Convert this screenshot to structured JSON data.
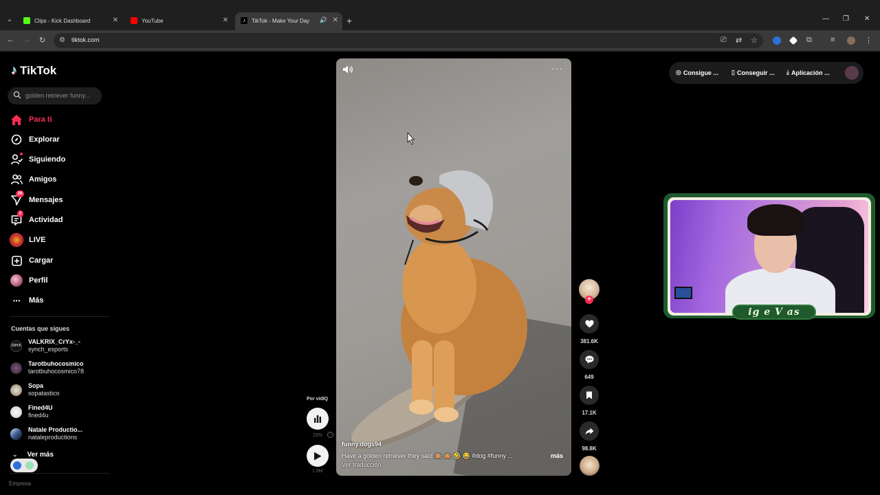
{
  "browser": {
    "tabs": [
      {
        "title": "Clips - Kick Dashboard",
        "favicon_color": "#53fc18"
      },
      {
        "title": "YouTube",
        "favicon_color": "#ff0000"
      },
      {
        "title": "TikTok - Make Your Day",
        "favicon_color": "#ffffff",
        "active": true
      }
    ],
    "url": "tiktok.com"
  },
  "tiktok": {
    "logo": "TikTok",
    "search_placeholder": "golden retriever funny...",
    "nav": [
      {
        "label": "Para ti",
        "icon": "home-icon",
        "active": true
      },
      {
        "label": "Explorar",
        "icon": "compass-icon"
      },
      {
        "label": "Siguiendo",
        "icon": "following-icon"
      },
      {
        "label": "Amigos",
        "icon": "friends-icon"
      },
      {
        "label": "Mensajes",
        "icon": "messages-icon",
        "badge": "28"
      },
      {
        "label": "Actividad",
        "icon": "activity-icon",
        "badge": "2"
      },
      {
        "label": "LIVE",
        "icon": "live-icon"
      },
      {
        "label": "Cargar",
        "icon": "upload-icon"
      },
      {
        "label": "Perfil",
        "icon": "profile-icon"
      },
      {
        "label": "Más",
        "icon": "more-icon"
      }
    ],
    "following_heading": "Cuentas que sigues",
    "following": [
      {
        "name": "VALKRIX_CrYx-_-",
        "handle": "synch_esports",
        "avatar_text": "CRYX"
      },
      {
        "name": "Tarotbuhocosmico",
        "handle": "tarotbuhocosmico78",
        "avatar_text": ""
      },
      {
        "name": "Sopa",
        "handle": "sopatastico",
        "avatar_text": ""
      },
      {
        "name": "Fined4U",
        "handle": "fined4u",
        "avatar_text": ""
      },
      {
        "name": "Natale Productio...",
        "handle": "nataleproductions",
        "avatar_text": ""
      }
    ],
    "see_more": "Ver más",
    "footer_cut": "Empresa",
    "video": {
      "author": "funny.dogs94",
      "caption": "Have a golden retriever they said 🙈 🙈 🤣 😂 #dog #funny ...",
      "more": "más",
      "translate": "Ver traducción"
    },
    "actions": {
      "likes": "381.6K",
      "comments": "649",
      "saves": "17.1K",
      "shares": "98.8K"
    },
    "top_buttons": [
      "Consigue ...",
      "Conseguir ...",
      "Aplicación ..."
    ]
  },
  "vidiq": {
    "label": "Por vidIQ",
    "percent": "25%",
    "views": "1.9M"
  },
  "webcam": {
    "tag": "ig  e V  as"
  },
  "colors": {
    "accent": "#fe2c55",
    "webcam_frame": "#1e5a2c"
  }
}
